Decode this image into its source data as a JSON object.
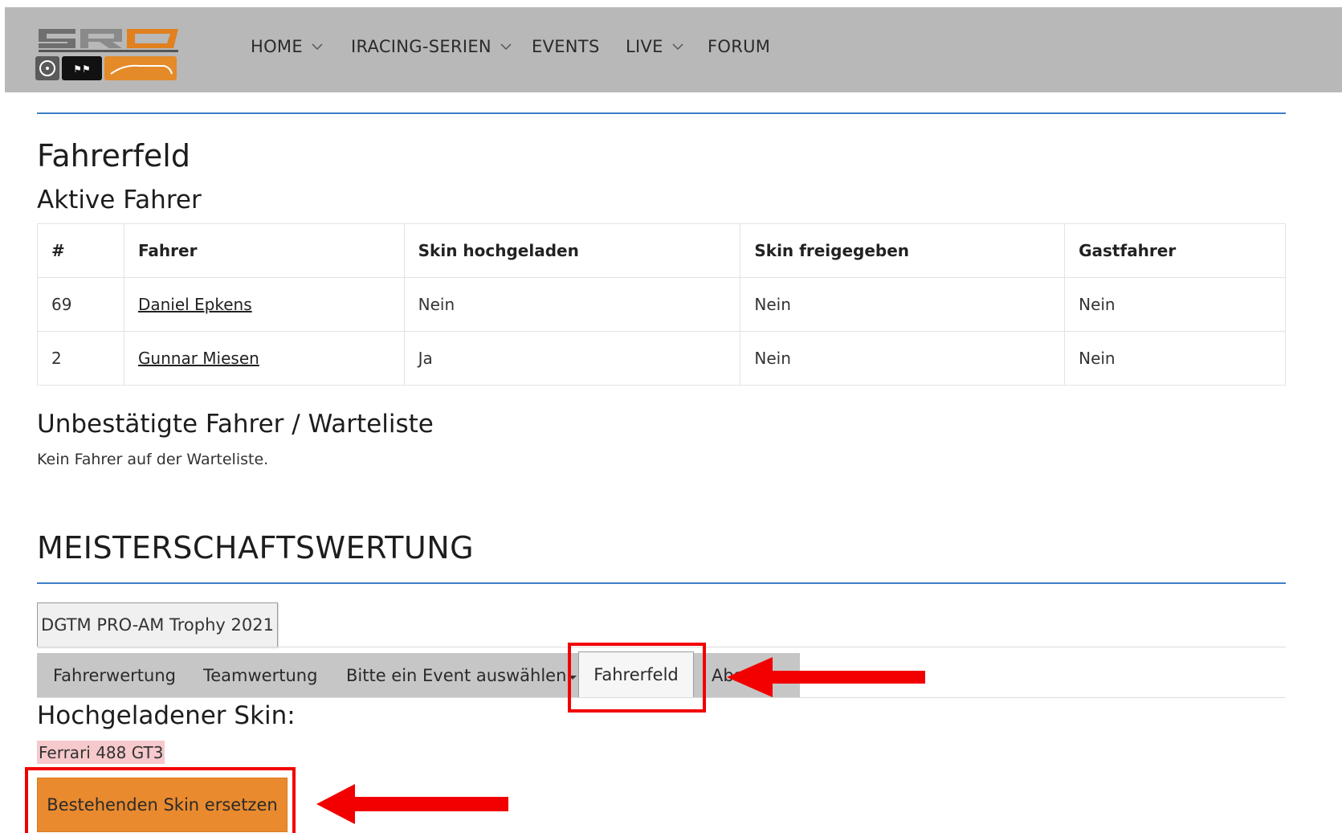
{
  "nav": {
    "items": [
      {
        "label": "HOME",
        "dropdown": true
      },
      {
        "label": "IRACING-SERIEN",
        "dropdown": true
      },
      {
        "label": "EVENTS",
        "dropdown": false
      },
      {
        "label": "LIVE",
        "dropdown": true
      },
      {
        "label": "FORUM",
        "dropdown": false
      }
    ]
  },
  "fahrerfeld": {
    "title": "Fahrerfeld",
    "aktive_title": "Aktive Fahrer",
    "columns": [
      "#",
      "Fahrer",
      "Skin hochgeladen",
      "Skin freigegeben",
      "Gastfahrer"
    ],
    "rows": [
      {
        "nr": "69",
        "fahrer": "Daniel Epkens",
        "skin_hochgeladen": "Nein",
        "skin_freigegeben": "Nein",
        "gastfahrer": "Nein"
      },
      {
        "nr": "2",
        "fahrer": "Gunnar Miesen",
        "skin_hochgeladen": "Ja",
        "skin_freigegeben": "Nein",
        "gastfahrer": "Nein"
      }
    ],
    "warteliste_title": "Unbestätigte Fahrer / Warteliste",
    "warteliste_text": "Kein Fahrer auf der Warteliste."
  },
  "meisterschaft": {
    "title": "MEISTERSCHAFTSWERTUNG",
    "trophy_button": "DGTM PRO-AM Trophy 2021",
    "tabs": {
      "fahrerwertung": "Fahrerwertung",
      "teamwertung": "Teamwertung",
      "event_select": "Bitte ein Event auswählen",
      "fahrerfeld": "Fahrerfeld",
      "abs": "Abs"
    }
  },
  "skin": {
    "title": "Hochgeladener Skin:",
    "car": "Ferrari 488 GT3",
    "replace_button": "Bestehenden Skin ersetzen"
  },
  "colors": {
    "topbar": "#b8b8b8",
    "accent_blue": "#3f7ec8",
    "annotation_red": "#f20000",
    "button_orange": "#ea8a2e",
    "skin_highlight": "#f6c9cc"
  }
}
